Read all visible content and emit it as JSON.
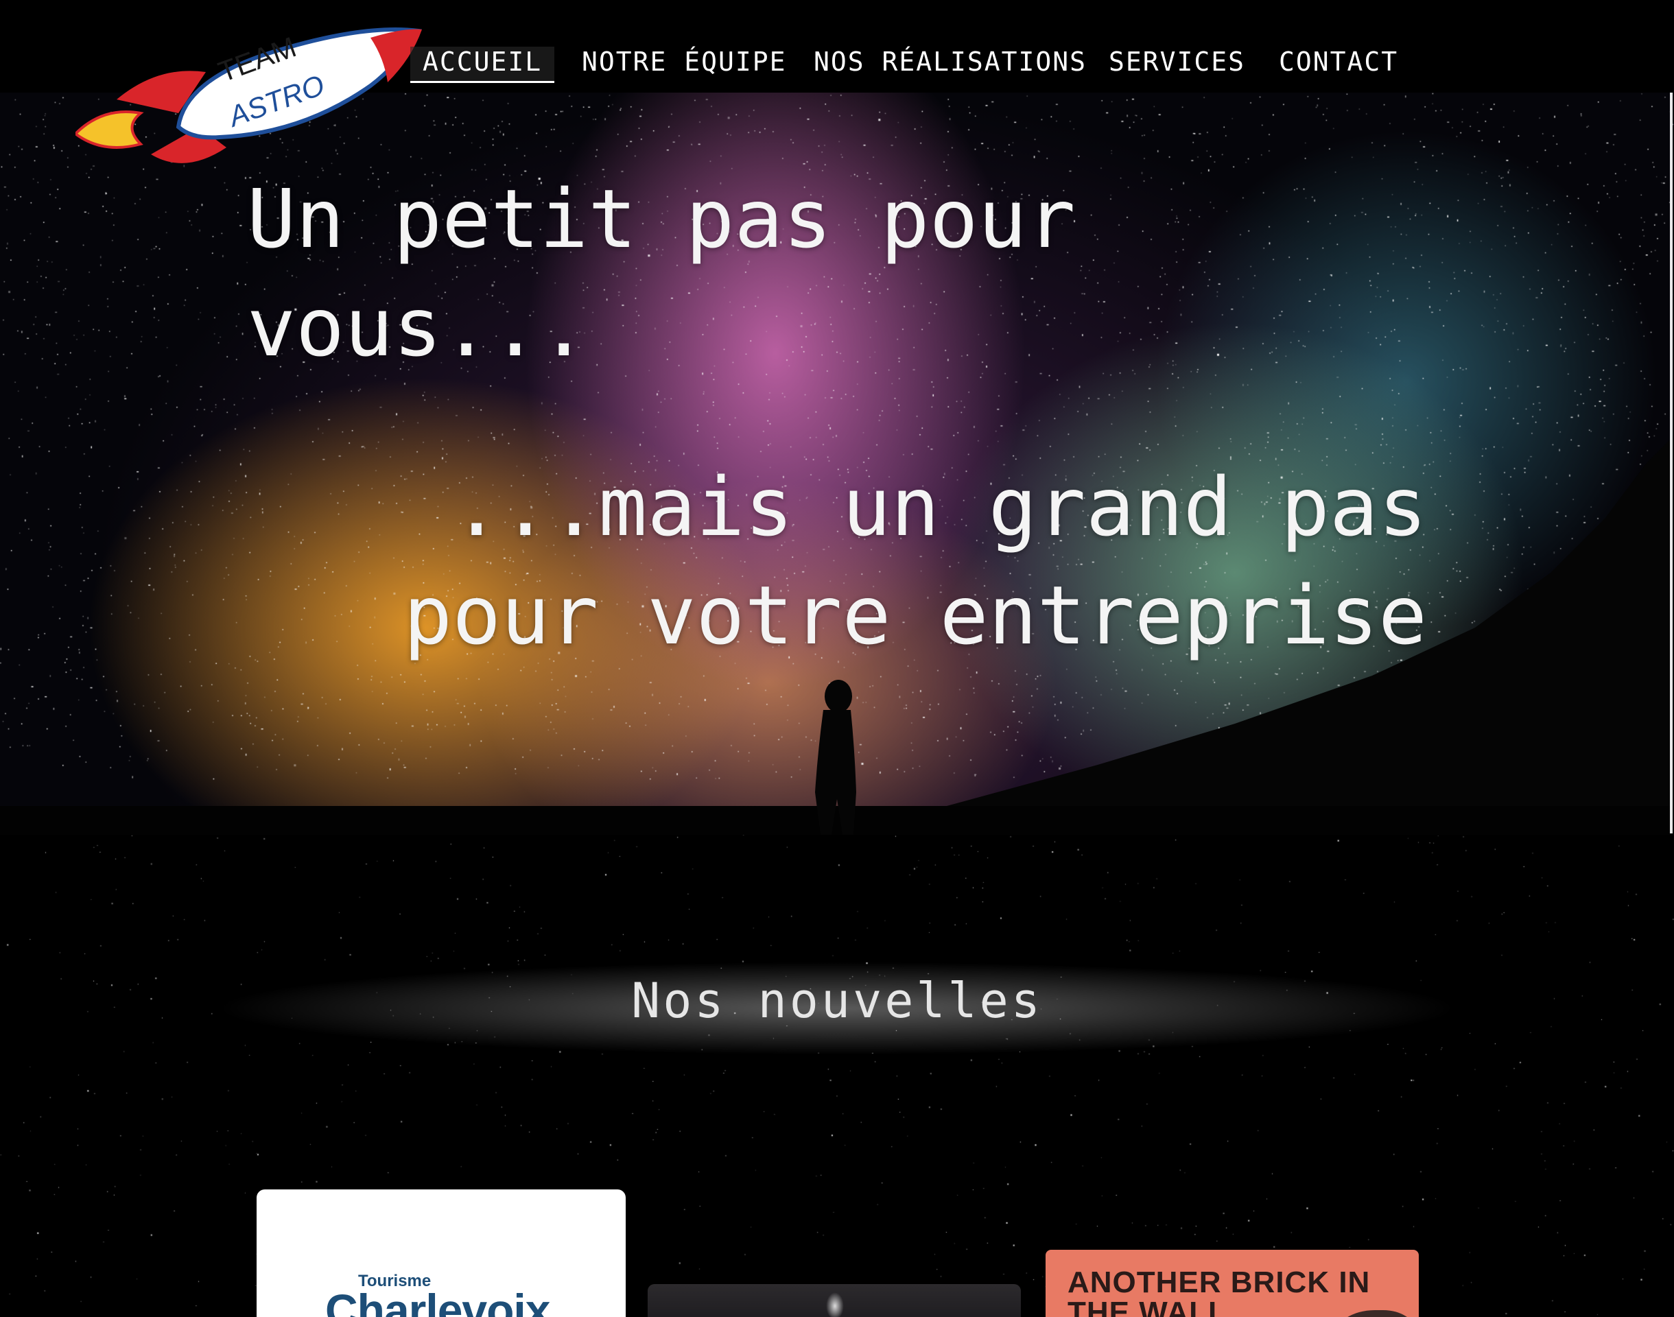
{
  "brand": {
    "logo_text_1": "TEAM",
    "logo_text_2": "ASTRO",
    "colors": {
      "rocket_red": "#d9252a",
      "flame_yellow": "#f5c22a",
      "logo_blue": "#1f4f9a"
    }
  },
  "nav": {
    "items": [
      {
        "label": "ACCUEIL",
        "active": true
      },
      {
        "label": "NOTRE ÉQUIPE",
        "active": false
      },
      {
        "label": "NOS RÉALISATIONS",
        "active": false
      },
      {
        "label": "SERVICES",
        "active": false
      },
      {
        "label": "CONTACT",
        "active": false
      }
    ]
  },
  "hero": {
    "headline_1": "Un petit pas pour vous...",
    "headline_2": "...mais un grand pas pour votre entreprise"
  },
  "news": {
    "title": "Nos nouvelles",
    "cards": [
      {
        "label_small": "Tourisme",
        "label_big": "Charlevoix"
      },
      {
        "label": ""
      },
      {
        "label": "ANOTHER BRICK IN THE WALL"
      }
    ]
  }
}
